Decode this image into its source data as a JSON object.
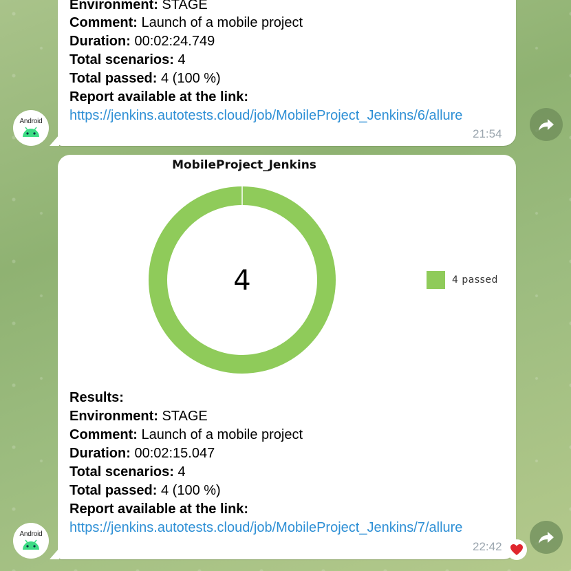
{
  "messages": [
    {
      "lines": [
        {
          "label": "Environment:",
          "value": " STAGE"
        },
        {
          "label": "Comment:",
          "value": " Launch of a mobile project"
        },
        {
          "label": "Duration:",
          "value": " 00:02:24.749"
        },
        {
          "label": "Total scenarios:",
          "value": " 4"
        },
        {
          "label": "Total passed:",
          "value": " 4 (100 %)"
        },
        {
          "label": "Report available at the link:",
          "value": ""
        }
      ],
      "link": "https://jenkins.autotests.cloud/job/MobileProject_Jenkins/6/allure",
      "time": "21:54"
    },
    {
      "lines": [
        {
          "label": "Results:",
          "value": ""
        },
        {
          "label": "Environment:",
          "value": " STAGE"
        },
        {
          "label": "Comment:",
          "value": " Launch of a mobile project"
        },
        {
          "label": "Duration:",
          "value": " 00:02:15.047"
        },
        {
          "label": "Total scenarios:",
          "value": " 4"
        },
        {
          "label": "Total passed:",
          "value": " 4 (100 %)"
        },
        {
          "label": "Report available at the link:",
          "value": ""
        }
      ],
      "link": "https://jenkins.autotests.cloud/job/MobileProject_Jenkins/7/allure",
      "time": "22:42",
      "reaction": "heart-icon"
    }
  ],
  "avatar": {
    "text": "Android"
  },
  "colors": {
    "passed": "#8fcb5a",
    "link": "#2d8fd5",
    "heart": "#e0262e"
  },
  "chart_data": {
    "type": "pie",
    "title": "MobileProject_Jenkins",
    "center_label": "4",
    "series": [
      {
        "name": "4 passed",
        "value": 4
      }
    ],
    "legend": "right"
  }
}
